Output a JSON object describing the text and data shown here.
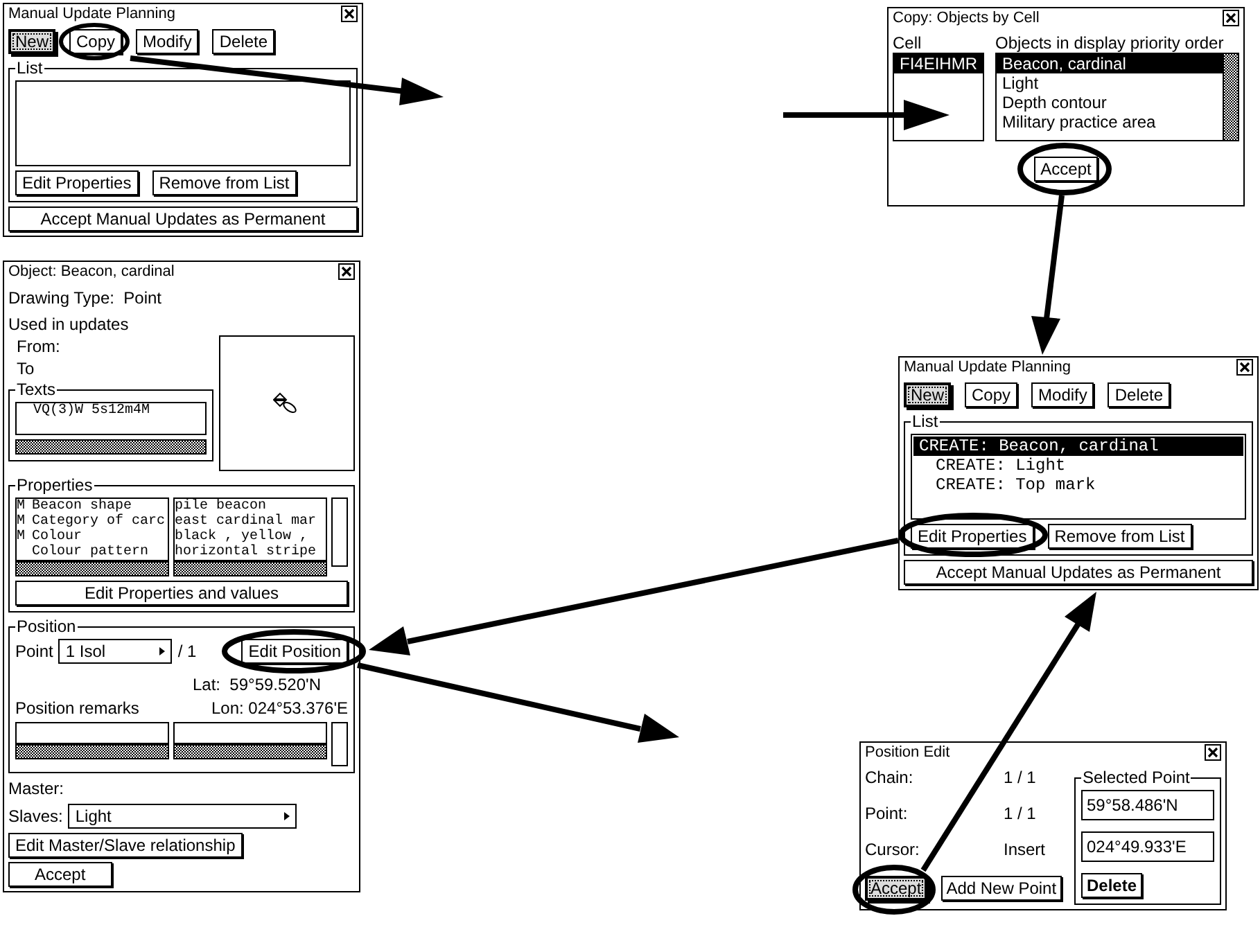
{
  "windows": [
    {
      "kind": "update_planning",
      "title": "Manual Update Planning",
      "buttons": [
        {
          "label": "New",
          "focused": true
        },
        {
          "label": "Copy",
          "focused": false
        },
        {
          "label": "Modify",
          "focused": false
        },
        {
          "label": "Delete",
          "focused": false
        }
      ],
      "list_label": "List",
      "list_buttons": [
        "Edit Properties",
        "Remove from List"
      ],
      "accept": "Accept Manual Updates as Permanent"
    },
    {
      "kind": "copy",
      "title": "Copy: Objects by Cell",
      "cell_label": "Cell",
      "objects_label": "Objects in display priority order",
      "cells": [
        {
          "label": "FI4EIHMR",
          "selected": true
        }
      ],
      "objects": [
        {
          "label": "Beacon, cardinal",
          "selected": true
        },
        {
          "label": "Light",
          "selected": false
        },
        {
          "label": "Depth contour",
          "selected": false
        },
        {
          "label": "Military practice area",
          "selected": false
        }
      ],
      "accept": "Accept"
    },
    {
      "kind": "object",
      "title": "Object: Beacon, cardinal",
      "drawing_type_label": "Drawing Type:",
      "drawing_type": "Point",
      "used_in": "Used in updates",
      "from": "From:",
      "to": "To",
      "texts_label": "Texts",
      "texts": [
        "VQ(3)W 5s12m4M"
      ],
      "properties_label": "Properties",
      "properties": [
        {
          "flag": "M",
          "name": "Beacon shape",
          "value": "pile beacon"
        },
        {
          "flag": "M",
          "name": "Category of carc",
          "value": "east cardinal mar"
        },
        {
          "flag": "M",
          "name": "Colour",
          "value": "black , yellow ,"
        },
        {
          "name": "Colour pattern",
          "value": "horizontal stripe"
        }
      ],
      "edit_properties": "Edit Properties and values",
      "position_label": "Position",
      "point_label": "Point",
      "point_value": "1 Isol",
      "point_total": "/ 1",
      "edit_position": "Edit Position",
      "lat_label": "Lat:",
      "lat": "59°59.520'N",
      "remarks_label": "Position remarks",
      "lon_label": "Lon:",
      "lon": "024°53.376'E",
      "master": "Master:",
      "slaves_label": "Slaves:",
      "slaves_value": "Light",
      "master_slave": "Edit Master/Slave relationship",
      "accept": "Accept"
    },
    {
      "kind": "update_planning",
      "title": "Manual Update Planning",
      "buttons": [
        {
          "label": "New",
          "focused": true
        },
        {
          "label": "Copy",
          "focused": false
        },
        {
          "label": "Modify",
          "focused": false
        },
        {
          "label": "Delete",
          "focused": false
        }
      ],
      "list_label": "List",
      "list_items": [
        {
          "label": "CREATE: Beacon, cardinal",
          "selected": true,
          "children": [
            {
              "label": "CREATE: Light",
              "selected": false
            },
            {
              "label": "CREATE: Top mark",
              "selected": false
            }
          ]
        }
      ],
      "list_buttons": [
        "Edit Properties",
        "Remove from List"
      ],
      "accept": "Accept Manual Updates as Permanent"
    },
    {
      "kind": "position_edit",
      "title": "Position Edit",
      "rows": [
        {
          "label": "Chain:",
          "value": "1  / 1"
        },
        {
          "label": "Point:",
          "value": "1  / 1"
        },
        {
          "label": "Cursor:",
          "value": "Insert"
        }
      ],
      "buttons": [
        {
          "label": "Accept",
          "focused": true
        },
        {
          "label": "Add New Point",
          "focused": false
        }
      ],
      "selected_label": "Selected Point",
      "lat": "59°58.486'N",
      "lon": "024°49.933'E",
      "delete": "Delete"
    }
  ]
}
